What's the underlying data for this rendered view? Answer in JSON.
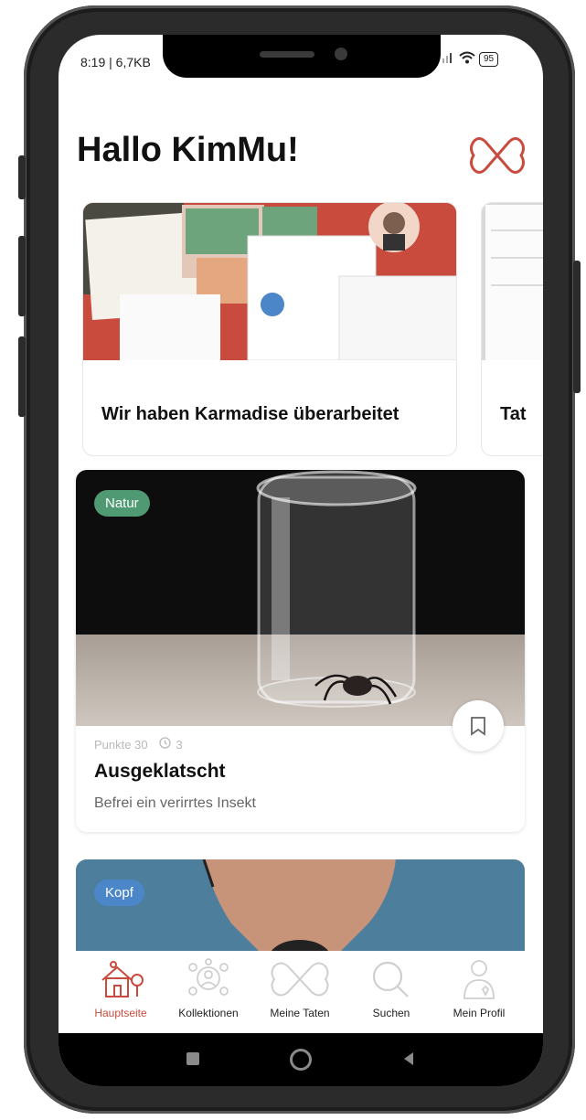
{
  "status": {
    "time": "8:19 | 6,7KB",
    "battery": "95"
  },
  "greeting": "Hallo KimMu!",
  "carousel": [
    {
      "title": "Wir haben Karmadise überarbeitet"
    },
    {
      "title": "Tat"
    }
  ],
  "activity": {
    "tag": "Natur",
    "points_label": "Punkte 30",
    "count": "3",
    "title": "Ausgeklatscht",
    "subtitle": "Befrei ein verirrtes Insekt"
  },
  "activity2": {
    "tag": "Kopf"
  },
  "nav": [
    {
      "label": "Hauptseite",
      "icon": "home-icon",
      "active": true
    },
    {
      "label": "Kollektionen",
      "icon": "collections-icon",
      "active": false
    },
    {
      "label": "Meine Taten",
      "icon": "karma-icon",
      "active": false
    },
    {
      "label": "Suchen",
      "icon": "search-icon",
      "active": false
    },
    {
      "label": "Mein Profil",
      "icon": "profile-icon",
      "active": false
    }
  ],
  "colors": {
    "brand": "#c94b3e",
    "natur_tag": "#4f9a72",
    "kopf_tag": "#4a86c8"
  }
}
